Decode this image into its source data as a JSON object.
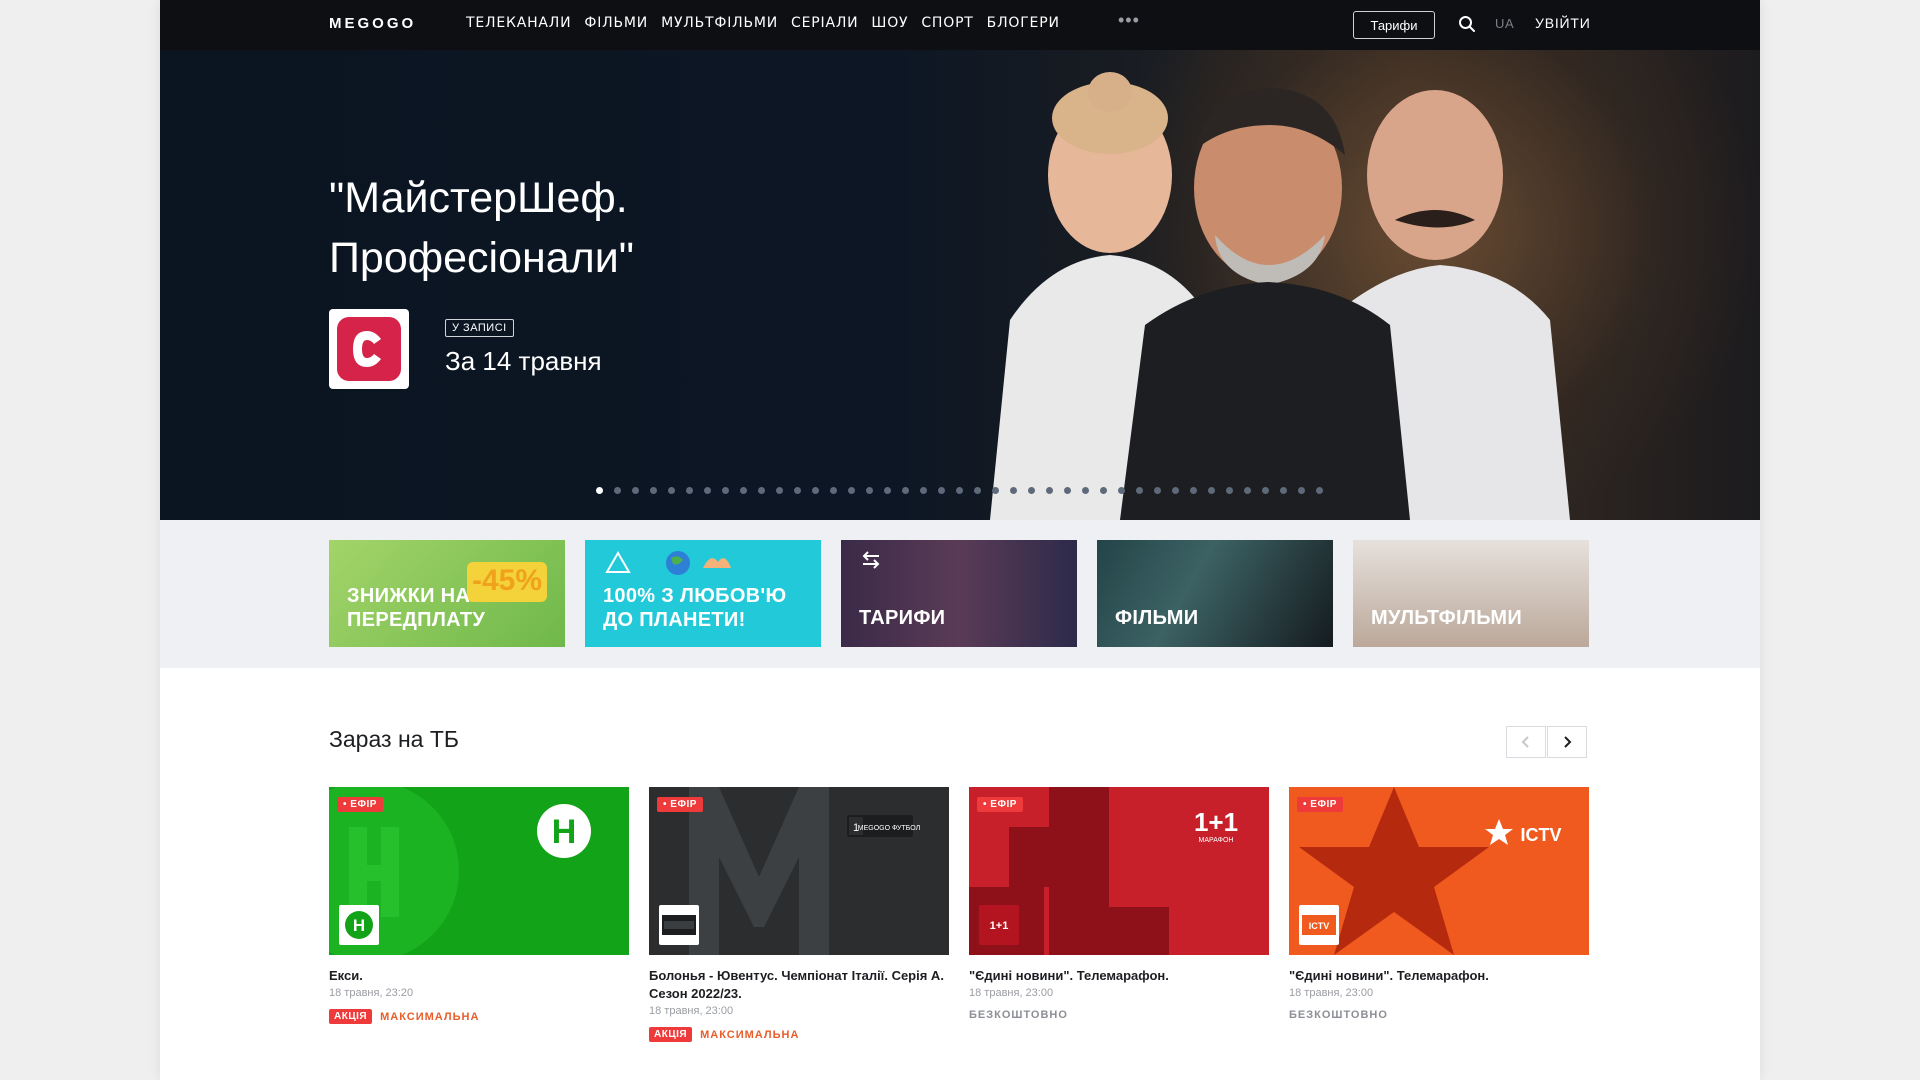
{
  "header": {
    "logo": "MEGOGO",
    "nav": [
      "ТЕЛЕКАНАЛИ",
      "ФІЛЬМИ",
      "МУЛЬТФІЛЬМИ",
      "СЕРІАЛИ",
      "ШОУ",
      "СПОРТ",
      "БЛОГЕРИ"
    ],
    "more": "•••",
    "tariff_button": "Тарифи",
    "lang": "UA",
    "login": "УВІЙТИ"
  },
  "hero": {
    "title": "\"МайстерШеф. Професіонали\"",
    "badge": "У ЗАПИСІ",
    "date": "За 14 травня",
    "slide_count": 41,
    "active_slide": 0
  },
  "promos": [
    {
      "label": "ЗНИЖКИ НА ПЕРЕДПЛАТУ",
      "badge": "-45%",
      "color": "#8ecb5a"
    },
    {
      "label": "100% З ЛЮБОВ'Ю ДО ПЛАНЕТИ!",
      "color": "#22c9d8"
    },
    {
      "label": "ТАРИФИ",
      "color": "#3b2a44"
    },
    {
      "label": "ФІЛЬМИ",
      "color": "#1e3a3e"
    },
    {
      "label": "МУЛЬТФІЛЬМИ",
      "color": "#cfc6c0"
    }
  ],
  "now_on_tv": {
    "title": "Зараз на ТБ",
    "cards": [
      {
        "live": "• ЕФІР",
        "title": "Екси.",
        "time": "18 травня, 23:20",
        "promo": "АКЦІЯ",
        "plan": "МАКСИМАЛЬНА",
        "free": ""
      },
      {
        "live": "• ЕФІР",
        "title": "Болонья - Ювентус. Чемпіонат Італії. Серія А. Сезон 2022/23.",
        "time": "18 травня, 23:00",
        "promo": "АКЦІЯ",
        "plan": "МАКСИМАЛЬНА",
        "free": "",
        "channel_text": "MEGOGO ФУТБОЛ"
      },
      {
        "live": "• ЕФІР",
        "title": "\"Єдині новини\". Телемарафон.",
        "time": "18 травня, 23:00",
        "promo": "",
        "plan": "",
        "free": "БЕЗКОШТОВНО",
        "channel_text": "1+1 МАРАФОН"
      },
      {
        "live": "• ЕФІР",
        "title": "\"Єдині новини\". Телемарафон.",
        "time": "18 травня, 23:00",
        "promo": "",
        "plan": "",
        "free": "БЕЗКОШТОВНО",
        "channel_text": "ICTV"
      }
    ]
  },
  "colors": {
    "accent": "#ee3a3a",
    "plan": "#e85d2a",
    "header_bg": "#0d0f13"
  }
}
